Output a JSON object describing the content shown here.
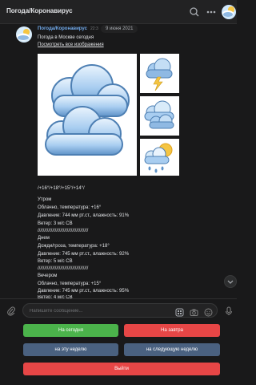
{
  "header": {
    "title": "Погода/Коронавирус",
    "icons": [
      "search-icon",
      "bell-icon",
      "more-icon"
    ]
  },
  "message": {
    "sender": "Погода/Коронавирус",
    "time": "22:3",
    "date_pill": "9 июня 2021",
    "title": "Погода в Москве сегодня",
    "link": "Посмотреть все изображения",
    "temps": "/+16°/+18°/+15°/+14°/",
    "morning_label": "Утром",
    "morning_desc": "Облачно, температура: +16°",
    "morning_pressure": "Давление: 744 мм рт.ст., влажность: 91%",
    "morning_wind": "Ветер: 3 м/с СВ",
    "divider1": "//////////////////////////////////////",
    "day_label": "Днем",
    "day_desc": "Дожди/гроза, температура: +18°",
    "day_pressure": "Давление: 745 мм рт.ст., влажность: 92%",
    "day_wind": "Ветер: 5 м/с СВ",
    "divider2": "//////////////////////////////////////",
    "evening_label": "Вечером",
    "evening_desc": "Облачно, температура: +15°",
    "evening_pressure": "Давление: 745 мм рт.ст., влажность: 95%",
    "evening_wind": "Ветер: 4 м/с СВ"
  },
  "composer": {
    "placeholder": "Напишите сообщение..."
  },
  "keyboard": {
    "today": "На сегодня",
    "tomorrow": "На завтра",
    "this_week": "на эту неделю",
    "next_week": "на следующую неделю",
    "exit": "Выйти"
  },
  "colors": {
    "green": "#4bb34b",
    "red": "#e64646",
    "blue": "#4a6180",
    "link": "#71aaeb"
  }
}
